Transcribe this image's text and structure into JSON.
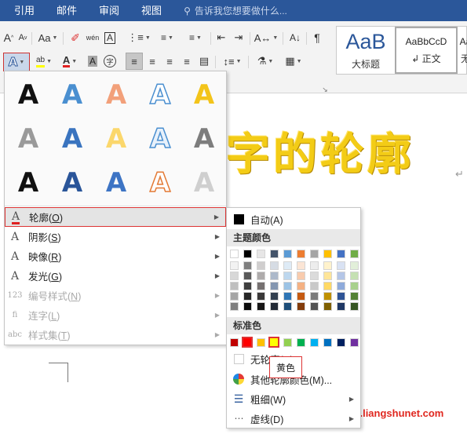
{
  "tabs": [
    "引用",
    "邮件",
    "审阅",
    "视图"
  ],
  "tell_me": "告诉我您想要做什么...",
  "ribbon": {
    "font_grow": "A",
    "font_shrink": "A",
    "change_case": "Aa",
    "phonetic": "wén",
    "char_border": "A",
    "highlight": "ab",
    "font_color": "A",
    "char_shade": "A",
    "enclose": "字"
  },
  "styles": [
    {
      "preview": "AaB",
      "label": "大标题"
    },
    {
      "preview": "AaBbCcD",
      "label": "↲ 正文"
    },
    {
      "preview": "Aa",
      "label": "无"
    }
  ],
  "document": {
    "text": "字的轮廓",
    "para_mark": "↵"
  },
  "fx_grid": [
    [
      {
        "color": "#111"
      },
      {
        "color": "#4a8fd0"
      },
      {
        "color": "#f2a07a"
      },
      {
        "color": "#fff",
        "stroke": "#4a8fd0"
      },
      {
        "color": "#f3c41a"
      }
    ],
    [
      {
        "color": "#9a9a9a"
      },
      {
        "color": "#3a74bf"
      },
      {
        "color": "#fbd76c"
      },
      {
        "color": "#e8f1fb",
        "stroke": "#4a8fd0"
      },
      {
        "color": "#7d7d7d"
      }
    ],
    [
      {
        "color": "#111"
      },
      {
        "color": "#2a5599"
      },
      {
        "color": "#3d74c4"
      },
      {
        "color": "#fff",
        "stroke": "#e37a35"
      },
      {
        "color": "#cfcfcf"
      }
    ]
  ],
  "fx_menu": [
    {
      "icon": "A",
      "label": "轮廓(",
      "key": "O",
      "close": ")",
      "enabled": true,
      "selected": true
    },
    {
      "icon": "A",
      "label": "阴影(",
      "key": "S",
      "close": ")",
      "enabled": true
    },
    {
      "icon": "A",
      "label": "映像(",
      "key": "R",
      "close": ")",
      "enabled": true
    },
    {
      "icon": "A",
      "label": "发光(",
      "key": "G",
      "close": ")",
      "enabled": true
    },
    {
      "icon": "123",
      "label": "编号样式(",
      "key": "N",
      "close": ")",
      "enabled": false
    },
    {
      "icon": "fi",
      "label": "连字(",
      "key": "L",
      "close": ")",
      "enabled": false
    },
    {
      "icon": "abc",
      "label": "样式集(",
      "key": "T",
      "close": ")",
      "enabled": false
    }
  ],
  "outline_menu": {
    "auto": "自动(A)",
    "theme_header": "主题颜色",
    "std_header": "标准色",
    "no_outline": "无轮廓(N)",
    "more_colors": "其他轮廓颜色(M)...",
    "weight": "粗细(W)",
    "dashes": "虚线(D)"
  },
  "theme_colors": [
    [
      "#ffffff",
      "#000000",
      "#e7e6e6",
      "#44546a",
      "#5b9bd5",
      "#ed7d31",
      "#a5a5a5",
      "#ffc000",
      "#4472c4",
      "#70ad47"
    ],
    [
      "#f2f2f2",
      "#7f7f7f",
      "#d0cece",
      "#d6dce4",
      "#deebf6",
      "#fbe5d5",
      "#ededed",
      "#fff2cc",
      "#d9e2f3",
      "#e2efd9"
    ],
    [
      "#d8d8d8",
      "#595959",
      "#aeabab",
      "#adb9ca",
      "#bdd7ee",
      "#f8cbad",
      "#dbdbdb",
      "#fee599",
      "#b4c6e7",
      "#c5e0b3"
    ],
    [
      "#bfbfbf",
      "#3f3f3f",
      "#757070",
      "#8496b0",
      "#9cc3e5",
      "#f4b183",
      "#c9c9c9",
      "#ffd965",
      "#8eaadb",
      "#a8d08d"
    ],
    [
      "#a5a5a5",
      "#262626",
      "#3a3838",
      "#323f4f",
      "#2e75b5",
      "#c55a11",
      "#7b7b7b",
      "#bf9000",
      "#2f5496",
      "#538135"
    ],
    [
      "#7f7f7f",
      "#0c0c0c",
      "#171616",
      "#222a35",
      "#1e4e79",
      "#833c0b",
      "#525252",
      "#7f6000",
      "#1f3864",
      "#375623"
    ]
  ],
  "standard_colors": [
    "#c00000",
    "#ff0000",
    "#ffc000",
    "#ffff00",
    "#92d050",
    "#00b050",
    "#00b0f0",
    "#0070c0",
    "#002060",
    "#7030a0"
  ],
  "tooltip": "黄色",
  "watermark": "亮术网 www.liangshunet.com"
}
